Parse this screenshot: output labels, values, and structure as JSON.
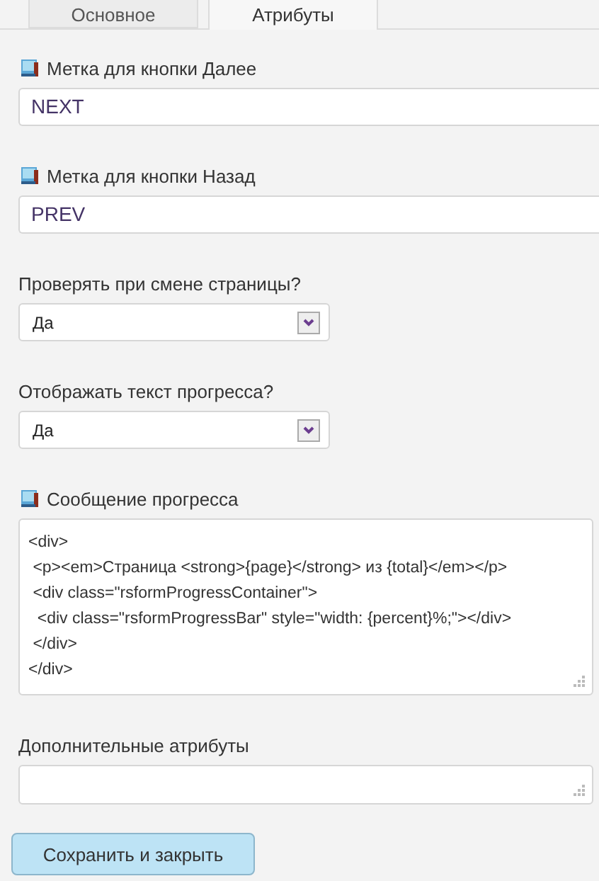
{
  "tabs": [
    {
      "label": "Основное",
      "selected": false
    },
    {
      "label": "Атрибуты",
      "selected": true
    }
  ],
  "fields": [
    {
      "kind": "text",
      "label": "Метка для кнопки Далее",
      "has_icon": true,
      "value": "NEXT"
    },
    {
      "kind": "text",
      "label": "Метка для кнопки Назад",
      "has_icon": true,
      "value": "PREV"
    },
    {
      "kind": "select",
      "label": "Проверять при смене страницы?",
      "has_icon": false,
      "value": "Да"
    },
    {
      "kind": "select",
      "label": "Отображать текст прогресса?",
      "has_icon": false,
      "value": "Да"
    },
    {
      "kind": "textarea",
      "label": "Сообщение прогресса",
      "has_icon": true,
      "value": "<div>\n <p><em>Страница <strong>{page}</strong> из {total}</em></p>\n <div class=\"rsformProgressContainer\">\n  <div class=\"rsformProgressBar\" style=\"width: {percent}%;\"></div>\n </div>\n</div>"
    },
    {
      "kind": "textarea-small",
      "label": "Дополнительные атрибуты",
      "has_icon": false
    }
  ],
  "button": "Сохранить и закрыть"
}
